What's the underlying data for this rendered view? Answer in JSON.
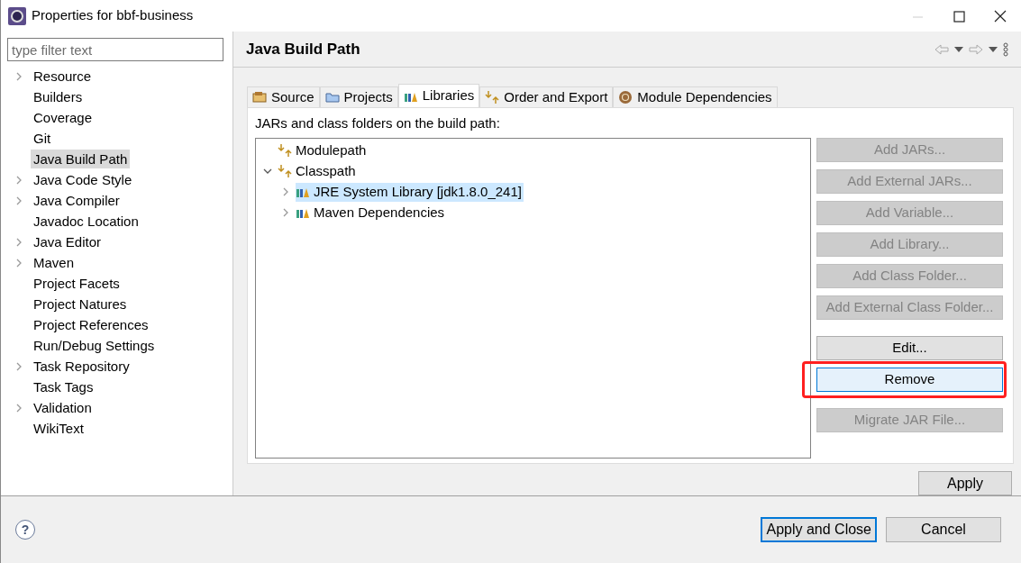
{
  "window": {
    "title": "Properties for bbf-business"
  },
  "filter": {
    "placeholder": "type filter text"
  },
  "sidebar": {
    "items": [
      {
        "label": "Resource",
        "expandable": true,
        "selected": false
      },
      {
        "label": "Builders",
        "expandable": false,
        "selected": false
      },
      {
        "label": "Coverage",
        "expandable": false,
        "selected": false
      },
      {
        "label": "Git",
        "expandable": false,
        "selected": false
      },
      {
        "label": "Java Build Path",
        "expandable": false,
        "selected": true
      },
      {
        "label": "Java Code Style",
        "expandable": true,
        "selected": false
      },
      {
        "label": "Java Compiler",
        "expandable": true,
        "selected": false
      },
      {
        "label": "Javadoc Location",
        "expandable": false,
        "selected": false
      },
      {
        "label": "Java Editor",
        "expandable": true,
        "selected": false
      },
      {
        "label": "Maven",
        "expandable": true,
        "selected": false
      },
      {
        "label": "Project Facets",
        "expandable": false,
        "selected": false
      },
      {
        "label": "Project Natures",
        "expandable": false,
        "selected": false
      },
      {
        "label": "Project References",
        "expandable": false,
        "selected": false
      },
      {
        "label": "Run/Debug Settings",
        "expandable": false,
        "selected": false
      },
      {
        "label": "Task Repository",
        "expandable": true,
        "selected": false
      },
      {
        "label": "Task Tags",
        "expandable": false,
        "selected": false
      },
      {
        "label": "Validation",
        "expandable": true,
        "selected": false
      },
      {
        "label": "WikiText",
        "expandable": false,
        "selected": false
      }
    ]
  },
  "page": {
    "title": "Java Build Path",
    "tabs": [
      {
        "label": "Source",
        "selected": false
      },
      {
        "label": "Projects",
        "selected": false
      },
      {
        "label": "Libraries",
        "selected": true
      },
      {
        "label": "Order and Export",
        "selected": false
      },
      {
        "label": "Module Dependencies",
        "selected": false
      }
    ],
    "tree_label": "JARs and class folders on the build path:",
    "tree": [
      {
        "label": "Modulepath",
        "kind": "path",
        "selected": false
      },
      {
        "label": "Classpath",
        "kind": "path",
        "expanded": true,
        "selected": false,
        "children": [
          {
            "label": "JRE System Library [jdk1.8.0_241]",
            "kind": "library",
            "expanded": false,
            "selected": true
          },
          {
            "label": "Maven Dependencies",
            "kind": "library",
            "expanded": false,
            "selected": false
          }
        ]
      }
    ],
    "button_groups": [
      [
        {
          "label": "Add JARs...",
          "disabled": true,
          "focused": false,
          "annotated": false
        },
        {
          "label": "Add External JARs...",
          "disabled": true,
          "focused": false,
          "annotated": false
        },
        {
          "label": "Add Variable...",
          "disabled": true,
          "focused": false,
          "annotated": false
        },
        {
          "label": "Add Library...",
          "disabled": true,
          "focused": false,
          "annotated": false
        },
        {
          "label": "Add Class Folder...",
          "disabled": true,
          "focused": false,
          "annotated": false
        },
        {
          "label": "Add External Class Folder...",
          "disabled": true,
          "focused": false,
          "annotated": false
        }
      ],
      [
        {
          "label": "Edit...",
          "disabled": false,
          "focused": false,
          "annotated": false
        },
        {
          "label": "Remove",
          "disabled": false,
          "focused": true,
          "annotated": true
        }
      ],
      [
        {
          "label": "Migrate JAR File...",
          "disabled": true,
          "focused": false,
          "annotated": false
        }
      ]
    ],
    "apply": "Apply"
  },
  "footer": {
    "help": "?",
    "buttons": [
      {
        "label": "Apply and Close",
        "default": true
      },
      {
        "label": "Cancel",
        "default": false
      }
    ]
  }
}
